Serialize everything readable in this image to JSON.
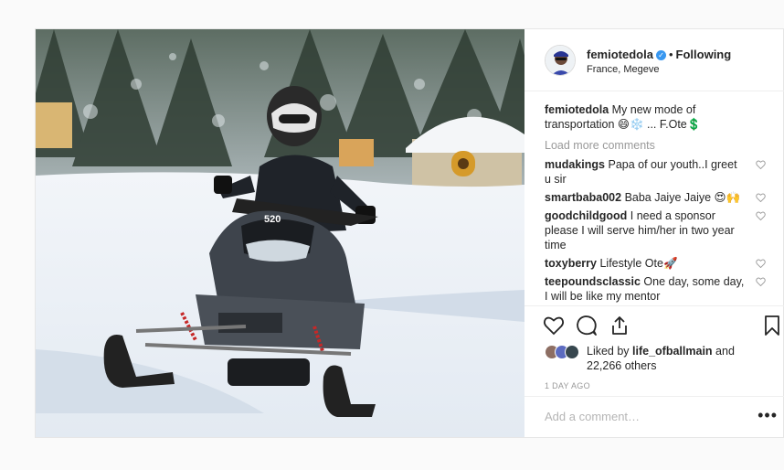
{
  "post": {
    "username": "femiotedola",
    "separator": "•",
    "follow_label": "Following",
    "location": "France, Megeve",
    "caption_user": "femiotedola",
    "caption_text": "My new mode of transportation 😄❄️ ... F.Ote💲",
    "load_more": "Load more comments",
    "comments": [
      {
        "user": "mudakings",
        "text": "Papa of our youth..I greet u sir"
      },
      {
        "user": "smartbaba002",
        "text": "Baba Jaiye Jaiye 😍🙌"
      },
      {
        "user": "goodchildgood",
        "text": "I need a sponsor please I will serve him/her in two year time"
      },
      {
        "user": "toxyberry",
        "text": "Lifestyle Ote🚀"
      },
      {
        "user": "teepoundsclassic",
        "text": "One day, some day, I will be like my mentor"
      }
    ],
    "liked_prefix": "Liked by ",
    "liked_user": "life_ofballmain",
    "liked_mid": " and",
    "liked_count": "22,266 others",
    "time_ago": "1 DAY AGO",
    "add_comment_placeholder": "Add a comment…",
    "more_label": "•••"
  },
  "colors": {
    "verified": "#3897f0",
    "muted": "#999999",
    "border": "#efefef"
  },
  "icons": [
    "verified-badge-icon",
    "heart-icon",
    "comment-icon",
    "share-icon",
    "bookmark-icon",
    "small-heart-icon",
    "more-options-icon"
  ]
}
